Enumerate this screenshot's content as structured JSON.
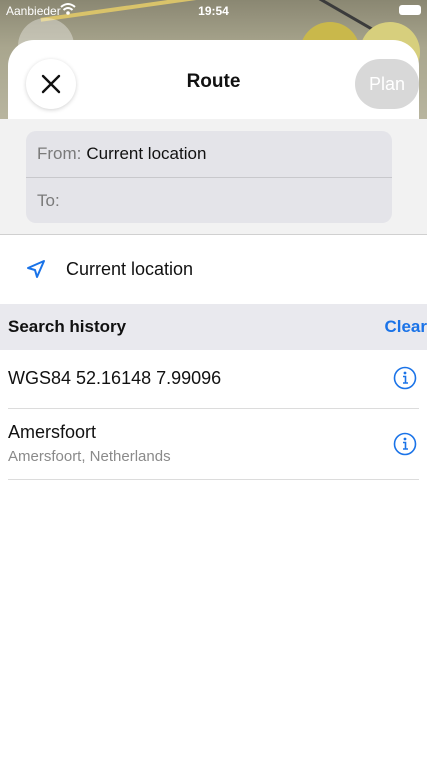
{
  "status_bar": {
    "carrier": "Aanbieder",
    "time": "19:54"
  },
  "navbar": {
    "title": "Route",
    "plan_label": "Plan",
    "close_icon": "close-x-icon"
  },
  "fields": {
    "from_label": "From:",
    "from_value": "Current location",
    "to_label": "To:",
    "to_value": ""
  },
  "current_location": {
    "label": "Current location",
    "icon": "location-arrow-icon",
    "accent_color": "#1a73e8"
  },
  "search_history": {
    "title": "Search history",
    "clear_label": "Clear",
    "items": [
      {
        "title": "WGS84 52.16148 7.99096",
        "subtitle": ""
      },
      {
        "title": "Amersfoort",
        "subtitle": "Amersfoort, Netherlands"
      }
    ]
  }
}
